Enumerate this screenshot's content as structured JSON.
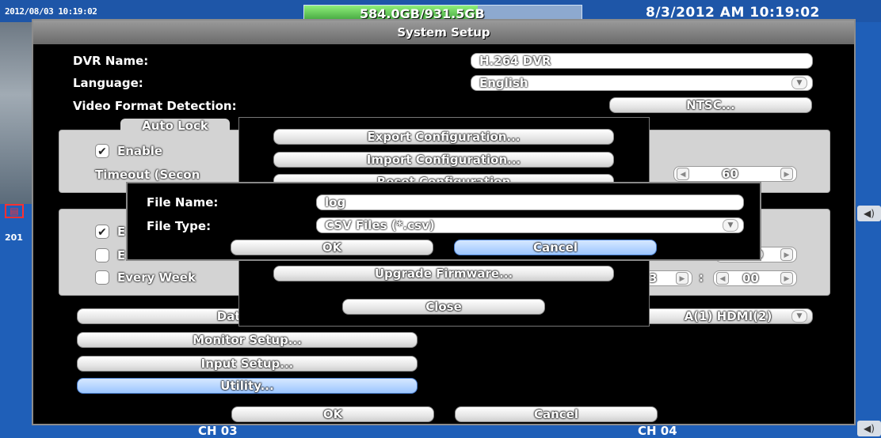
{
  "status_bar": {
    "left_timestamp": "2012/08/03 10:19:02",
    "disk_usage": "584.0GB/931.5GB",
    "disk_fraction": 0.627,
    "clock": "8/3/2012 AM 10:19:02"
  },
  "left_timestamp2": "201",
  "window": {
    "title": "System Setup"
  },
  "fields": {
    "dvr_name_label": "DVR Name:",
    "dvr_name_value": "H.264 DVR",
    "language_label": "Language:",
    "language_value": "English",
    "video_format_label": "Video Format Detection:",
    "video_format_value": "NTSC..."
  },
  "auto_lock": {
    "title": "Auto Lock",
    "enable_label": "Enable",
    "timeout_label": "Timeout (Secon",
    "timeout_value": "60"
  },
  "schedule": {
    "row1_label": "E",
    "row2_label": "E",
    "row3_label": "Every Week",
    "value_a": "0",
    "value_b": "3",
    "value_c": "00"
  },
  "left_buttons": {
    "date_time": "Date/Tim",
    "monitor": "Monitor Setup...",
    "input": "Input Setup...",
    "utility": "Utility..."
  },
  "output_select": "A(1)  HDMI(2)",
  "main_buttons": {
    "ok": "OK",
    "cancel": "Cancel"
  },
  "utility_menu": {
    "export": "Export Configuration...",
    "import": "Import Configuration...",
    "reset": "Reset Configuration",
    "upgrade": "Upgrade Firmware...",
    "close": "Close"
  },
  "file_dialog": {
    "name_label": "File Name:",
    "name_value": "log",
    "type_label": "File Type:",
    "type_value": "CSV Files (*.csv)",
    "ok": "OK",
    "cancel": "Cancel"
  },
  "bottom_bar": {
    "left_channel": "CH 03",
    "right_channel": "CH 04"
  },
  "icons": {
    "camera_alert": "film-icon",
    "speaker": "speaker-icon",
    "checkbox_checked": "check-icon",
    "dropdown": "chevron-down-icon",
    "spin_left": "triangle-left-icon",
    "spin_right": "triangle-right-icon"
  }
}
